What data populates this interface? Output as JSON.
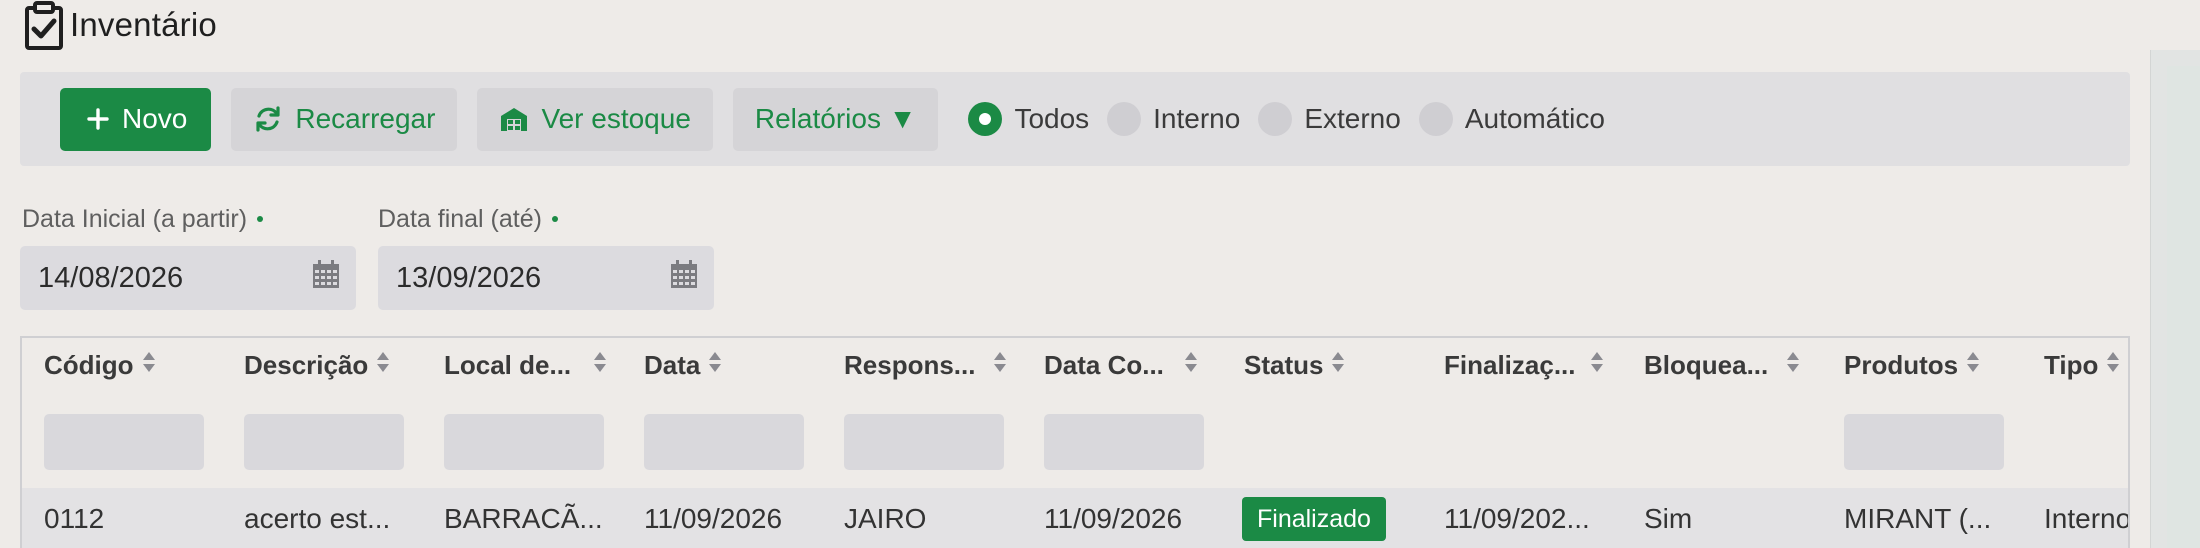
{
  "header": {
    "title": "Inventário",
    "icon": "clipboard-check-icon"
  },
  "toolbar": {
    "new_label": "Novo",
    "reload_label": "Recarregar",
    "stock_label": "Ver estoque",
    "reports_label": "Relatórios ▼",
    "filters": [
      {
        "label": "Todos",
        "checked": true
      },
      {
        "label": "Interno",
        "checked": false
      },
      {
        "label": "Externo",
        "checked": false
      },
      {
        "label": "Automático",
        "checked": false
      }
    ]
  },
  "dates": {
    "start_label": "Data Inicial (a partir)",
    "start_value": "14/08/2026",
    "end_label": "Data final (até)",
    "end_value": "13/09/2026"
  },
  "table": {
    "columns": [
      "Código",
      "Descrição",
      "Local de...",
      "Data",
      "Respons...",
      "Data Co...",
      "Status",
      "Finalizaç...",
      "Bloquea...",
      "Produtos",
      "Tipo"
    ],
    "rows": [
      {
        "codigo": "0112",
        "descricao": "acerto est...",
        "local": "BARRACÃ...",
        "data": "11/09/2026",
        "responsavel": "JAIRO",
        "data_co": "11/09/2026",
        "status": "Finalizado",
        "finalizacao": "11/09/202...",
        "bloqueado": "Sim",
        "produtos": "MIRANT (...",
        "tipo": "Interno"
      }
    ]
  },
  "colors": {
    "accent": "#1b8a45",
    "toolbar_bg": "#e0dfe1",
    "page_bg": "#eeebe8"
  }
}
